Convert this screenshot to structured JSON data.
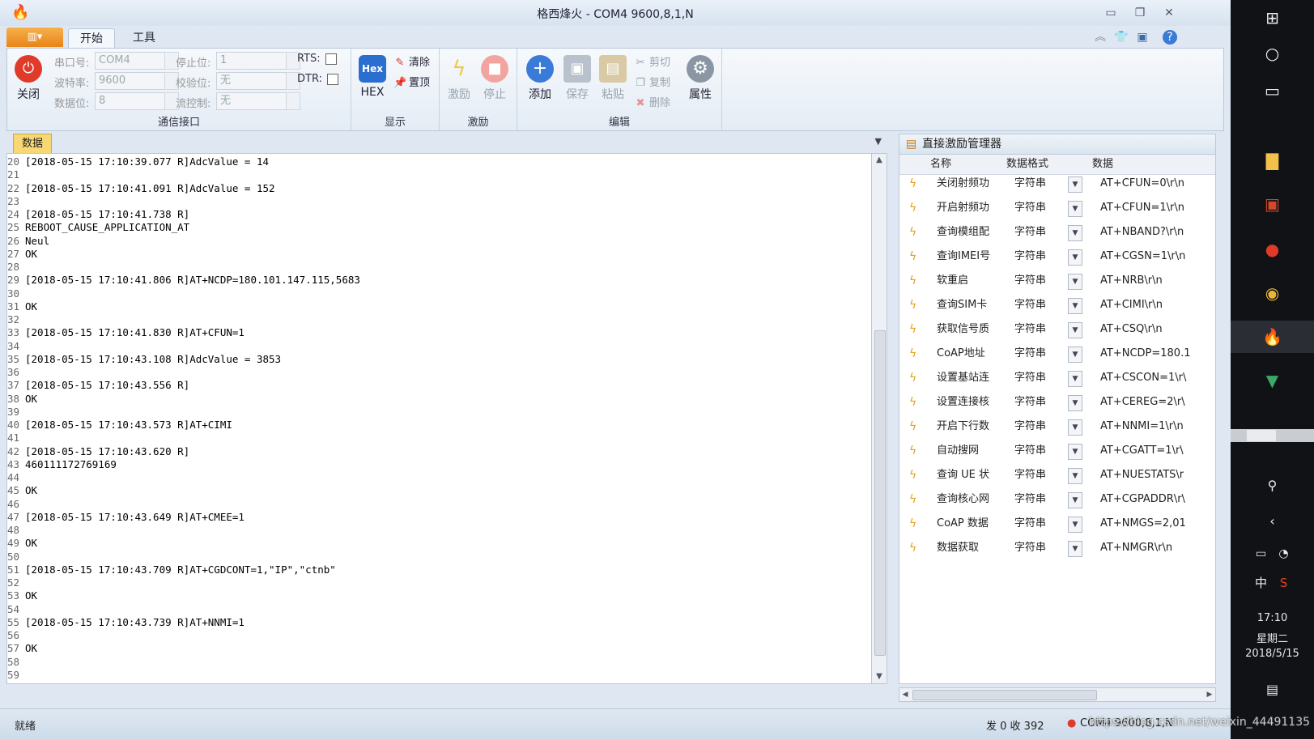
{
  "window": {
    "title": "格西烽火 - COM4  9600,8,1,N"
  },
  "tabs": [
    {
      "label": "开始"
    },
    {
      "label": "工具"
    }
  ],
  "ribbon": {
    "comm": {
      "close_label": "关闭",
      "port_label": "串口号:",
      "port_value": "COM4",
      "baud_label": "波特率:",
      "baud_value": "9600",
      "databits_label": "数据位:",
      "databits_value": "8",
      "stopbits_label": "停止位:",
      "stopbits_value": "1",
      "parity_label": "校验位:",
      "parity_value": "无",
      "flow_label": "流控制:",
      "flow_value": "无",
      "rts_label": "RTS:",
      "dtr_label": "DTR:",
      "group_label": "通信接口"
    },
    "display": {
      "hex_label": "HEX",
      "clear_label": "清除",
      "top_label": "置顶",
      "group_label": "显示"
    },
    "stimulus": {
      "stimulate_label": "激励",
      "stop_label": "停止",
      "group_label": "激励"
    },
    "edit": {
      "add_label": "添加",
      "save_label": "保存",
      "paste_label": "粘贴",
      "cut_label": "剪切",
      "copy_label": "复制",
      "delete_label": "删除",
      "props_label": "属性",
      "group_label": "编辑"
    }
  },
  "data_panel": {
    "tab_label": "数据",
    "lines": [
      {
        "n": "20",
        "t": "[2018-05-15 17:10:39.077 R]AdcValue = 14"
      },
      {
        "n": "21",
        "t": ""
      },
      {
        "n": "22",
        "t": "[2018-05-15 17:10:41.091 R]AdcValue = 152"
      },
      {
        "n": "23",
        "t": ""
      },
      {
        "n": "24",
        "t": "[2018-05-15 17:10:41.738 R]"
      },
      {
        "n": "25",
        "t": "REBOOT_CAUSE_APPLICATION_AT"
      },
      {
        "n": "26",
        "t": "Neul"
      },
      {
        "n": "27",
        "t": "OK"
      },
      {
        "n": "28",
        "t": ""
      },
      {
        "n": "29",
        "t": "[2018-05-15 17:10:41.806 R]AT+NCDP=180.101.147.115,5683"
      },
      {
        "n": "30",
        "t": ""
      },
      {
        "n": "31",
        "t": "OK"
      },
      {
        "n": "32",
        "t": ""
      },
      {
        "n": "33",
        "t": "[2018-05-15 17:10:41.830 R]AT+CFUN=1"
      },
      {
        "n": "34",
        "t": ""
      },
      {
        "n": "35",
        "t": "[2018-05-15 17:10:43.108 R]AdcValue = 3853"
      },
      {
        "n": "36",
        "t": ""
      },
      {
        "n": "37",
        "t": "[2018-05-15 17:10:43.556 R]"
      },
      {
        "n": "38",
        "t": "OK"
      },
      {
        "n": "39",
        "t": ""
      },
      {
        "n": "40",
        "t": "[2018-05-15 17:10:43.573 R]AT+CIMI"
      },
      {
        "n": "41",
        "t": ""
      },
      {
        "n": "42",
        "t": "[2018-05-15 17:10:43.620 R]"
      },
      {
        "n": "43",
        "t": "460111172769169"
      },
      {
        "n": "44",
        "t": ""
      },
      {
        "n": "45",
        "t": "OK"
      },
      {
        "n": "46",
        "t": ""
      },
      {
        "n": "47",
        "t": "[2018-05-15 17:10:43.649 R]AT+CMEE=1"
      },
      {
        "n": "48",
        "t": ""
      },
      {
        "n": "49",
        "t": "OK"
      },
      {
        "n": "50",
        "t": ""
      },
      {
        "n": "51",
        "t": "[2018-05-15 17:10:43.709 R]AT+CGDCONT=1,\"IP\",\"ctnb\""
      },
      {
        "n": "52",
        "t": ""
      },
      {
        "n": "53",
        "t": "OK"
      },
      {
        "n": "54",
        "t": ""
      },
      {
        "n": "55",
        "t": "[2018-05-15 17:10:43.739 R]AT+NNMI=1"
      },
      {
        "n": "56",
        "t": ""
      },
      {
        "n": "57",
        "t": "OK"
      },
      {
        "n": "58",
        "t": ""
      },
      {
        "n": "59",
        "t": ""
      }
    ]
  },
  "manager": {
    "title": "直接激励管理器",
    "columns": [
      "名称",
      "数据格式",
      "数据"
    ],
    "rows": [
      {
        "name": "关闭射频功",
        "fmt": "字符串",
        "data": "AT+CFUN=0\\r\\n"
      },
      {
        "name": "开启射频功",
        "fmt": "字符串",
        "data": "AT+CFUN=1\\r\\n"
      },
      {
        "name": "查询模组配",
        "fmt": "字符串",
        "data": "AT+NBAND?\\r\\n"
      },
      {
        "name": "查询IMEI号",
        "fmt": "字符串",
        "data": "AT+CGSN=1\\r\\n"
      },
      {
        "name": "软重启",
        "fmt": "字符串",
        "data": "AT+NRB\\r\\n"
      },
      {
        "name": "查询SIM卡",
        "fmt": "字符串",
        "data": "AT+CIMI\\r\\n"
      },
      {
        "name": "获取信号质",
        "fmt": "字符串",
        "data": "AT+CSQ\\r\\n"
      },
      {
        "name": "CoAP地址",
        "fmt": "字符串",
        "data": "AT+NCDP=180.1"
      },
      {
        "name": "设置基站连",
        "fmt": "字符串",
        "data": "AT+CSCON=1\\r\\"
      },
      {
        "name": "设置连接核",
        "fmt": "字符串",
        "data": "AT+CEREG=2\\r\\"
      },
      {
        "name": "开启下行数",
        "fmt": "字符串",
        "data": "AT+NNMI=1\\r\\n"
      },
      {
        "name": "自动搜网",
        "fmt": "字符串",
        "data": "AT+CGATT=1\\r\\"
      },
      {
        "name": "查询 UE 状",
        "fmt": "字符串",
        "data": "AT+NUESTATS\\r"
      },
      {
        "name": "查询核心网",
        "fmt": "字符串",
        "data": "AT+CGPADDR\\r\\"
      },
      {
        "name": "CoAP 数据",
        "fmt": "字符串",
        "data": "AT+NMGS=2,01"
      },
      {
        "name": "数据获取",
        "fmt": "字符串",
        "data": "AT+NMGR\\r\\n"
      }
    ]
  },
  "status": {
    "ready": "就绪",
    "counts": "发 0  收 392",
    "port": "COM4  9600,8,1,N"
  },
  "taskbar": {
    "time": "17:10",
    "weekday": "星期二",
    "date": "2018/5/15",
    "ime_label": "中"
  },
  "watermark": "https://blog.csdn.net/weixin_44491135",
  "colors": {
    "accent_orange": "#e8841a",
    "close_red": "#e03a2a",
    "hex_blue": "#2a6fd0",
    "bolt_yellow": "#e6a11c"
  }
}
